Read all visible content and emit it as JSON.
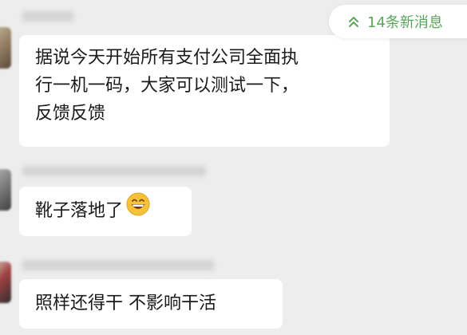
{
  "new_messages_pill": {
    "label": "14条新消息",
    "icon": "double-chevron-up-icon",
    "color": "#5ba55b"
  },
  "messages": [
    {
      "text": "据说今天开始所有支付公司全面执\n行一机一码，大家可以测试一下，\n反馈反馈"
    },
    {
      "text": "靴子落地了",
      "emoji": "grinning-face-icon"
    },
    {
      "text": "照样还得干  不影响干活"
    }
  ],
  "colors": {
    "background": "#ededed",
    "bubble": "#ffffff",
    "text": "#1a1a1a"
  }
}
